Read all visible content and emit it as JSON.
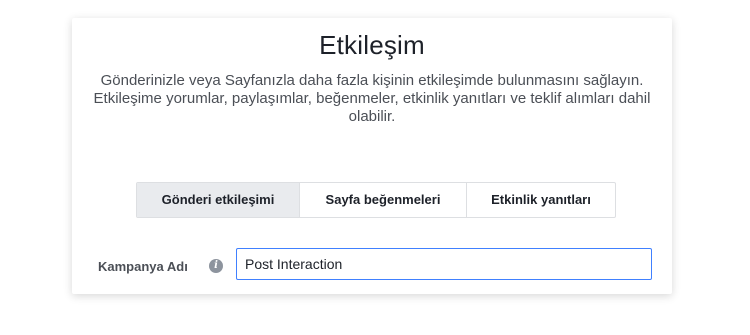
{
  "card": {
    "title": "Etkileşim",
    "description": "Gönderinizle veya Sayfanızla daha fazla kişinin etkileşimde bulunmasını sağlayın. Etkileşime yorumlar, paylaşımlar, beğenmeler, etkinlik yanıtları ve teklif alımları dahil olabilir."
  },
  "tabs": [
    {
      "label": "Gönderi etkileşimi",
      "active": true
    },
    {
      "label": "Sayfa beğenmeleri",
      "active": false
    },
    {
      "label": "Etkinlik yanıtları",
      "active": false
    }
  ],
  "campaign": {
    "label": "Kampanya Adı",
    "info_icon": "info-icon",
    "value": "Post Interaction"
  },
  "colors": {
    "active_tab_bg": "#e9ebee",
    "input_border": "#4080ff",
    "text_primary": "#1d2129",
    "text_secondary": "#4b4f56"
  }
}
